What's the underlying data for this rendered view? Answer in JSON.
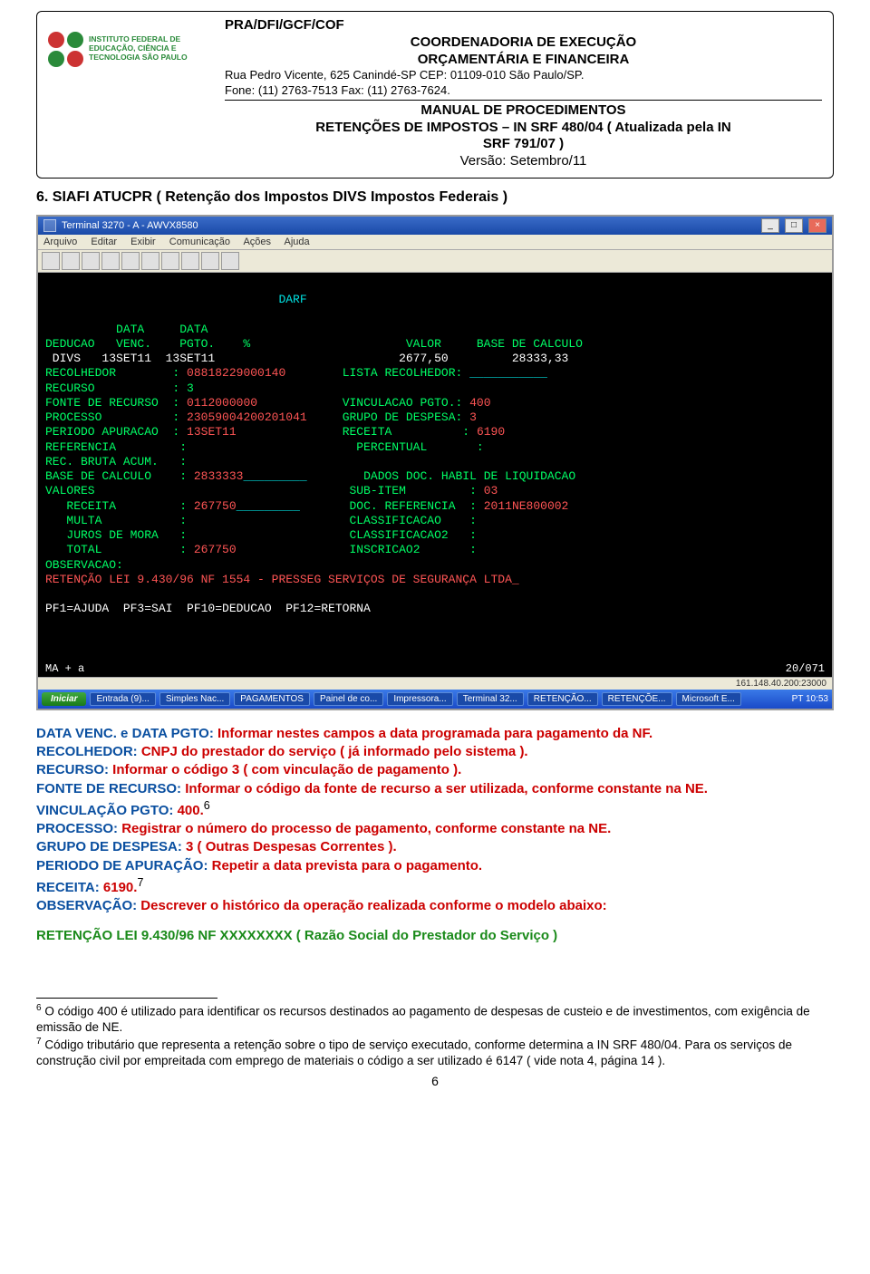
{
  "header": {
    "breadcrumb": "PRA/DFI/GCF/COF",
    "coord_line1": "COORDENADORIA DE EXECUÇÃO",
    "coord_line2": "ORÇAMENTÁRIA E FINANCEIRA",
    "address": "Rua Pedro Vicente, 625 Canindé-SP CEP: 01109-010 São Paulo/SP.",
    "phone": "Fone: (11) 2763-7513 Fax: (11) 2763-7624.",
    "manual_title": "MANUAL DE PROCEDIMENTOS",
    "manual_sub1": "RETENÇÕES DE IMPOSTOS – IN SRF 480/04 ( Atualizada pela IN",
    "manual_sub2": "SRF 791/07 )",
    "version": "Versão: Setembro/11",
    "logo_text": "INSTITUTO FEDERAL DE EDUCAÇÃO, CIÊNCIA E TECNOLOGIA SÃO PAULO"
  },
  "section_title": "6. SIAFI ATUCPR ( Retenção dos Impostos DIVS Impostos Federais )",
  "terminal": {
    "window_title": "Terminal 3270 - A - AWVX8580",
    "menu": [
      "Arquivo",
      "Editar",
      "Exibir",
      "Comunicação",
      "Ações",
      "Ajuda"
    ],
    "darf_title": "DARF",
    "col_head": "          DATA     DATA",
    "row_head": "DEDUCAO   VENC.    PGTO.    %                      VALOR     BASE DE CALCULO",
    "row1": " DIVS   13SET11  13SET11                          2677,50         28333,33",
    "recolhedor_label": "RECOLHEDOR        :",
    "recolhedor_val": "08818229000140",
    "lista_label": "LISTA RECOLHEDOR:",
    "recurso": "RECURSO           : 3",
    "fonte_label": "FONTE DE RECURSO  :",
    "fonte_val": "0112000000",
    "vinc_label": "VINCULACAO PGTO.:",
    "vinc_val": "400",
    "processo_label": "PROCESSO          :",
    "processo_val": "23059004200201041",
    "grupo_label": "GRUPO DE DESPESA:",
    "grupo_val": "3",
    "periodo_label": "PERIODO APURACAO  :",
    "periodo_val": "13SET11",
    "receita_label": "RECEITA          :",
    "receita_val": "6190",
    "referencia": "REFERENCIA         :                        PERCENTUAL       :",
    "bruta": "REC. BRUTA ACUM.   :",
    "base_label": "BASE DE CALCULO    :",
    "base_val": "2833333",
    "dados_doc": "DADOS DOC. HABIL DE LIQUIDACAO",
    "valores": "VALORES                                    SUB-ITEM         :",
    "subitem_val": "03",
    "receita_v_label": "   RECEITA         :",
    "receita_v_val": "267750",
    "docref_label": "DOC. REFERENCIA  :",
    "docref_val": "2011NE800002",
    "multa": "   MULTA           :                       CLASSIFICACAO    :",
    "juros": "   JUROS DE MORA   :                       CLASSIFICACAO2   :",
    "total_label": "   TOTAL           :",
    "total_val": "267750",
    "inscr_label": "INSCRICAO2       :",
    "obs": "OBSERVACAO:",
    "obs_line": "RETENÇÃO LEI 9.430/96 NF 1554 - PRESSEG SERVIÇOS DE SEGURANÇA LTDA_",
    "pf_keys": "PF1=AJUDA  PF3=SAI  PF10=DEDUCAO  PF12=RETORNA",
    "status_left": "MA  +  a",
    "status_right": "20/071",
    "ipbar": "161.148.40.200:23000",
    "taskbar": {
      "start": "Iniciar",
      "items": [
        "Entrada (9)...",
        "Simples Nac...",
        "PAGAMENTOS",
        "Painel de co...",
        "Impressora...",
        "Terminal 32...",
        "RETENÇÃO...",
        "RETENÇÕE...",
        "Microsoft E..."
      ],
      "clock": "PT  10:53"
    }
  },
  "body": [
    {
      "label": "DATA VENC. e DATA PGTO: ",
      "text": "Informar nestes campos a data programada para pagamento da NF."
    },
    {
      "label": "RECOLHEDOR: ",
      "text": "CNPJ do prestador do serviço ( já informado pelo sistema )."
    },
    {
      "label": "RECURSO: ",
      "text": "Informar o código 3 ( com vinculação de pagamento )."
    },
    {
      "label": "FONTE DE RECURSO: ",
      "text": "Informar o código da fonte de recurso a ser utilizada, conforme constante na NE."
    },
    {
      "label": "VINCULAÇÃO PGTO: ",
      "text": "400.",
      "sup": "6"
    },
    {
      "label": "PROCESSO: ",
      "text": "Registrar o número do processo de pagamento, conforme constante na NE."
    },
    {
      "label": "GRUPO DE DESPESA: ",
      "text": "3 ( Outras Despesas Correntes )."
    },
    {
      "label": "PERIODO DE APURAÇÃO: ",
      "text": "Repetir a data prevista para o pagamento."
    },
    {
      "label": "RECEITA: ",
      "text": "6190.",
      "sup": "7"
    },
    {
      "label": "OBSERVAÇÃO: ",
      "text": "Descrever o histórico da operação realizada conforme o modelo abaixo:"
    }
  ],
  "retention_line": "RETENÇÃO LEI 9.430/96 NF XXXXXXXX ( Razão Social do Prestador do Serviço )",
  "footnotes": {
    "f6": "O código 400 é utilizado para identificar os recursos destinados ao pagamento de despesas de custeio e de investimentos, com exigência de emissão de NE.",
    "f7": "Código tributário que representa a retenção sobre o tipo de serviço executado, conforme determina a IN SRF 480/04. Para os serviços de construção civil por empreitada com emprego de materiais o código a ser utilizado é 6147 ( vide nota 4, página 14 )."
  },
  "page_number": "6"
}
